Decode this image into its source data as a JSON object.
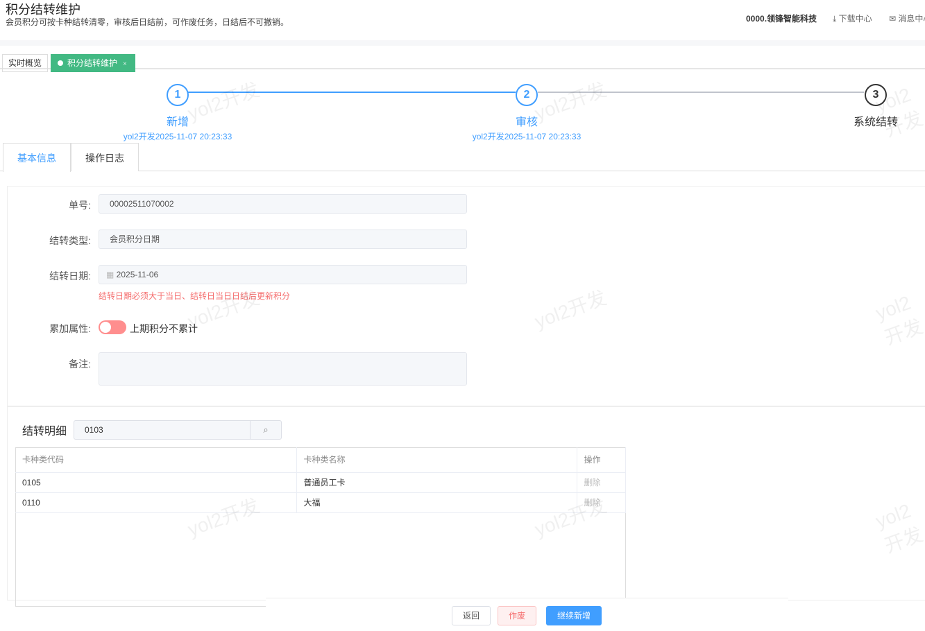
{
  "header": {
    "title": "积分结转维护",
    "subtitle": "会员积分可按卡种结转清零，审核后日结前，可作废任务，日结后不可撤销。",
    "company": "0000.领锋智能科技",
    "download": "下载中心",
    "messages": "消息中心"
  },
  "tabs": [
    {
      "label": "实时概览"
    },
    {
      "label": "积分结转维护",
      "close": "×"
    }
  ],
  "steps": [
    {
      "num": "1",
      "label": "新增",
      "time": "yol2开发2025-11-07 20:23:33"
    },
    {
      "num": "2",
      "label": "审核",
      "time": "yol2开发2025-11-07 20:23:33"
    },
    {
      "num": "3",
      "label": "系统结转"
    }
  ],
  "form_tabs": [
    "基本信息",
    "操作日志"
  ],
  "form": {
    "order_label": "单号:",
    "order": "00002511070002",
    "type_label": "结转类型:",
    "type": "会员积分日期",
    "date_label": "结转日期:",
    "date": "2025-11-06",
    "date_hint": "结转日期必须大于当日、结转日当日日结后更新积分",
    "accum_label": "累加属性:",
    "accum_text": "上期积分不累计",
    "remark_label": "备注:"
  },
  "detail": {
    "title": "结转明细",
    "search": "0103",
    "columns": [
      "卡种类代码",
      "卡种类名称",
      "操作"
    ],
    "rows": [
      {
        "code": "0105",
        "name": "普通员工卡",
        "op": "删除"
      },
      {
        "code": "0110",
        "name": "大福",
        "op": "删除"
      }
    ]
  },
  "footer": {
    "back": "返回",
    "void": "作废",
    "continue": "继续新增"
  },
  "watermark": "yol2开发"
}
